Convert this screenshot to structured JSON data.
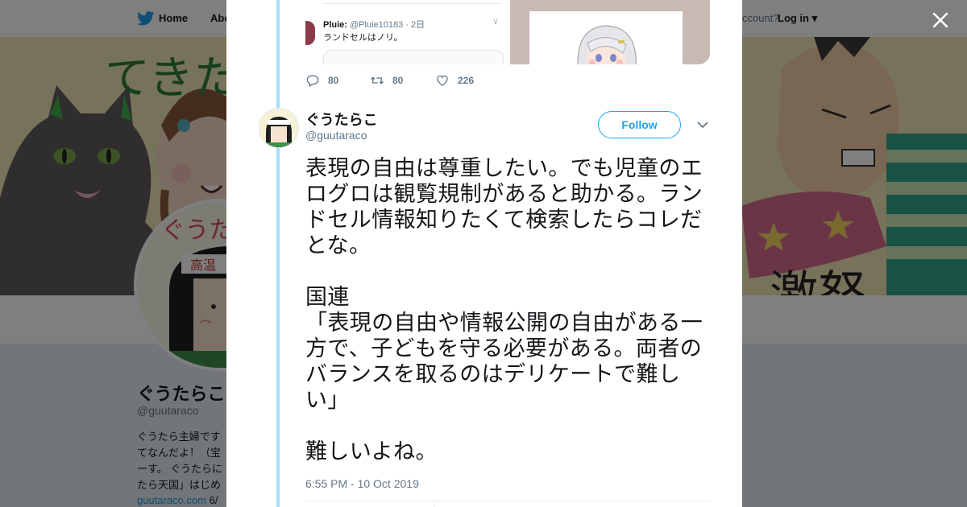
{
  "nav": {
    "home_label": "Home",
    "about_label": "Abo",
    "account_prompt": "ccount?",
    "login_label": "Log in"
  },
  "profile": {
    "name": "ぐうたらこ",
    "handle": "@guutaraco",
    "bio_lines": [
      "ぐうたら主婦です",
      "てなんだよ！（宝",
      "ーす。 ぐうたらに",
      "たら天国」はじめ"
    ],
    "link": "guutaraco.com",
    "link_suffix": "6/"
  },
  "parent_tweet": {
    "quoted": {
      "name": "Pluie:",
      "handle": "@Pluie10183 · 2日",
      "text": "ランドセルはノリ。"
    },
    "replies": "80",
    "retweets": "80",
    "likes": "226"
  },
  "tweet": {
    "name": "ぐうたらこ",
    "handle": "@guutaraco",
    "follow_label": "Follow",
    "text": "表現の自由は尊重したい。でも児童のエログロは観覧規制があると助かる。ランドセル情報知りたくて検索したらコレだとな。\n\n国連\n「表現の自由や情報公開の自由がある一方で、子どもを守る必要がある。両者のバランスを取るのはデリケートで難しい」\n\n難しいよね。",
    "timestamp": "6:55 PM - 10 Oct 2019"
  },
  "banner_text": {
    "top_left": "てきた",
    "bottom_right": "激怒",
    "avatar_arc": "ぐうた",
    "headband": "高温"
  },
  "colors": {
    "brand": "#1da1f2",
    "thread_line": "#a6dcf7"
  }
}
